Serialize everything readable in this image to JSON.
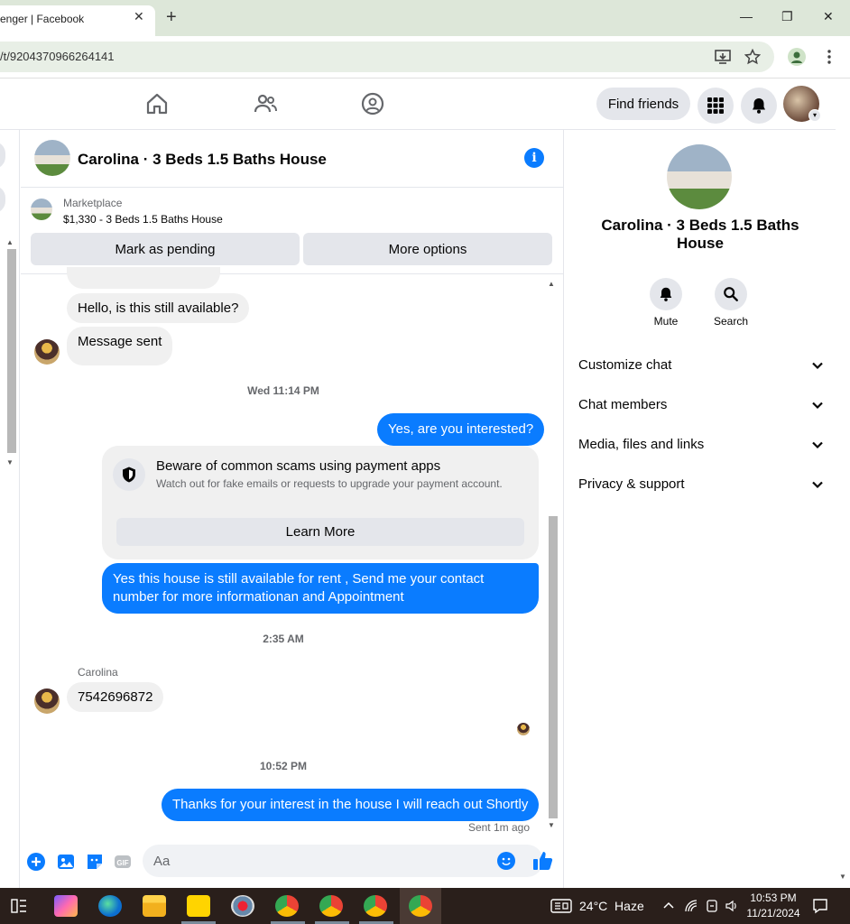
{
  "browser": {
    "tab_title": "enger | Facebook",
    "tab_close": "✕",
    "new_tab": "+",
    "url": "/t/9204370966264141",
    "window_controls": {
      "minimize": "—",
      "restore": "❐",
      "close": "✕"
    }
  },
  "fbnav": {
    "find_friends": "Find friends"
  },
  "conversation": {
    "header_title": "Carolina · 3 Beds 1.5 Baths House",
    "marketplace_label": "Marketplace",
    "listing": "$1,330 - 3 Beds 1.5 Baths House",
    "mark_pending": "Mark as pending",
    "more_options": "More options",
    "messages": {
      "m1": "Hello, is this still available?",
      "m2": "Message sent",
      "ts1": "Wed 11:14 PM",
      "m3": "Yes, are you interested?",
      "m5": "Yes this house is still available for rent , Send me your contact number for more informationan and Appointment",
      "ts2": "2:35 AM",
      "sender": "Carolina",
      "m6": "7542696872",
      "ts3": "10:52 PM",
      "m7": "Thanks for your interest in the house I will reach out Shortly",
      "status": "Sent 1m ago"
    },
    "scam_warning": {
      "title": "Beware of common scams using payment apps",
      "body": "Watch out for fake emails or requests to upgrade your payment account.",
      "button": "Learn More"
    },
    "composer": {
      "placeholder": "Aa"
    }
  },
  "info_panel": {
    "title": "Carolina · 3 Beds 1.5 Baths House",
    "mute": "Mute",
    "search": "Search",
    "sections": [
      "Customize chat",
      "Chat members",
      "Media, files and links",
      "Privacy & support"
    ]
  },
  "taskbar": {
    "weather": "24°C  Haze",
    "time": "10:53 PM",
    "date": "11/21/2024"
  },
  "colors": {
    "accent": "#0a7cff",
    "bubble_in": "#f0f0f0"
  }
}
